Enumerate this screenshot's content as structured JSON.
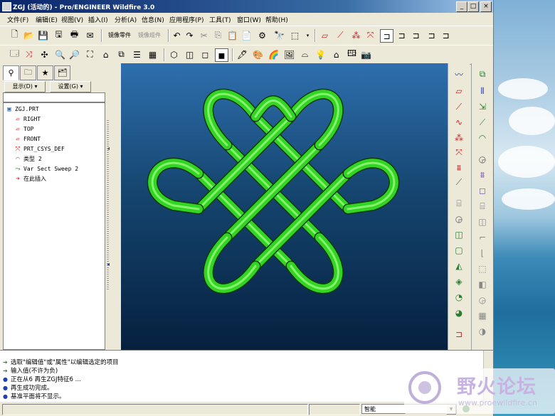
{
  "window": {
    "title": "ZGJ (活动的) - Pro/ENGINEER Wildfire 3.0",
    "minimize": "_",
    "maximize": "□",
    "close": "×"
  },
  "menu": [
    "文件(F)",
    "编辑(E)",
    "视图(V)",
    "插入(I)",
    "分析(A)",
    "信息(N)",
    "应用程序(P)",
    "工具(T)",
    "窗口(W)",
    "帮助(H)"
  ],
  "toolbar1": {
    "mirror_part": "镜像零件",
    "mirror_assembly": "镜像组件"
  },
  "left_panel": {
    "show_button": "显示(D) ▾",
    "settings_button": "设置(G) ▾",
    "tree": [
      {
        "label": "ZGJ.PRT",
        "icon": "part-icon"
      },
      {
        "label": "RIGHT",
        "icon": "datum-plane-icon"
      },
      {
        "label": "TOP",
        "icon": "datum-plane-icon"
      },
      {
        "label": "FRONT",
        "icon": "datum-plane-icon"
      },
      {
        "label": "PRT_CSYS_DEF",
        "icon": "csys-icon"
      },
      {
        "label": "类型 2",
        "icon": "feature-icon"
      },
      {
        "label": "Var Sect Sweep 2",
        "icon": "sweep-icon"
      },
      {
        "label": "在此插入",
        "icon": "insert-here-icon"
      }
    ]
  },
  "messages": [
    "选取\"编辑值\"或\"属性\"以编辑选定的项目",
    "输入值(不许为负)",
    "正在从6 再生ZGJ特征6 ...",
    "再生成功完成。",
    "基准平面将不显示。"
  ],
  "status": {
    "filter_value": "智能"
  },
  "watermark": {
    "title": "野火论坛",
    "url": "www.proewildfire.cn"
  },
  "colors": {
    "knot": "#33d424",
    "viewport_top": "#2e6fae",
    "viewport_bottom": "#06203f",
    "title_bar": "#0a246a"
  }
}
